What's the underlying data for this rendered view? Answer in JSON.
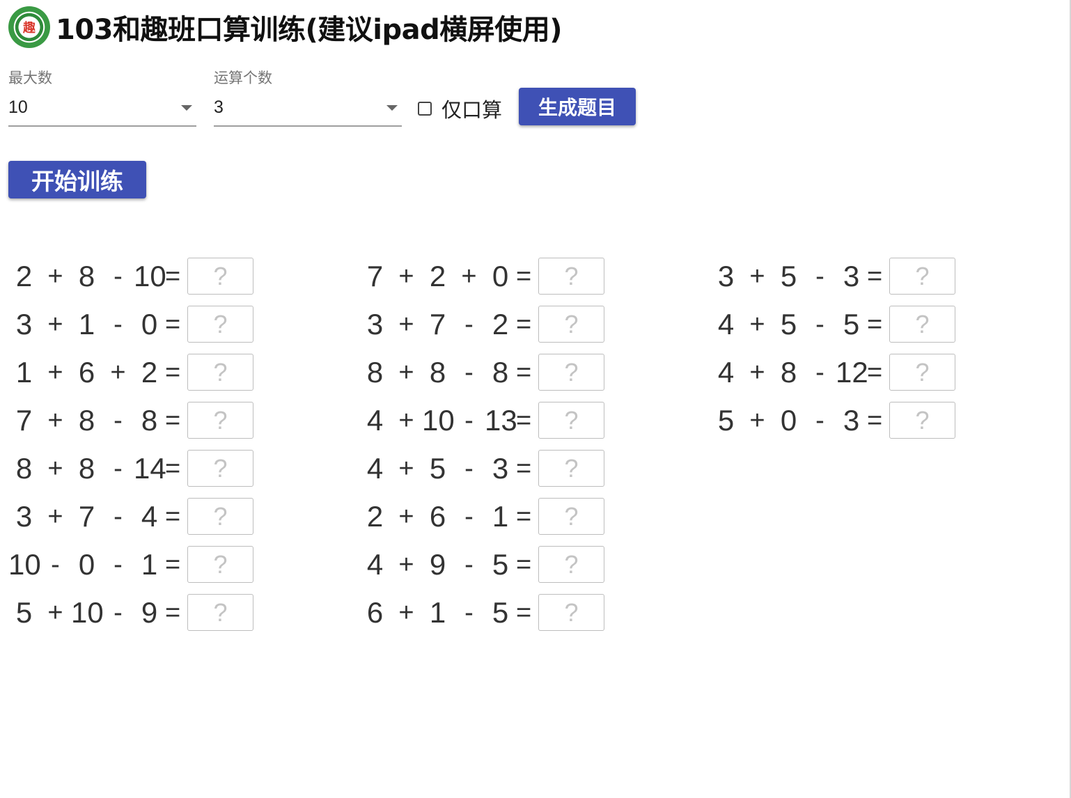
{
  "header": {
    "logo_icon": "school-logo-icon",
    "logo_char": "趣",
    "title": "103和趣班口算训练(建议ipad横屏使用)"
  },
  "controls": {
    "max_number": {
      "label": "最大数",
      "value": "10"
    },
    "operation_count": {
      "label": "运算个数",
      "value": "3"
    },
    "mental_only": {
      "label": "仅口算",
      "checked": false
    },
    "generate_button": "生成题目",
    "start_button": "开始训练"
  },
  "answer_placeholder": "?",
  "columns": [
    {
      "problems": [
        [
          "2",
          "+",
          "8",
          "-",
          "10",
          "="
        ],
        [
          "3",
          "+",
          "1",
          "-",
          "0",
          "="
        ],
        [
          "1",
          "+",
          "6",
          "+",
          "2",
          "="
        ],
        [
          "7",
          "+",
          "8",
          "-",
          "8",
          "="
        ],
        [
          "8",
          "+",
          "8",
          "-",
          "14",
          "="
        ],
        [
          "3",
          "+",
          "7",
          "-",
          "4",
          "="
        ],
        [
          "10",
          "-",
          "0",
          "-",
          "1",
          "="
        ],
        [
          "5",
          "+",
          "10",
          "-",
          "9",
          "="
        ]
      ]
    },
    {
      "problems": [
        [
          "7",
          "+",
          "2",
          "+",
          "0",
          "="
        ],
        [
          "3",
          "+",
          "7",
          "-",
          "2",
          "="
        ],
        [
          "8",
          "+",
          "8",
          "-",
          "8",
          "="
        ],
        [
          "4",
          "+",
          "10",
          "-",
          "13",
          "="
        ],
        [
          "4",
          "+",
          "5",
          "-",
          "3",
          "="
        ],
        [
          "2",
          "+",
          "6",
          "-",
          "1",
          "="
        ],
        [
          "4",
          "+",
          "9",
          "-",
          "5",
          "="
        ],
        [
          "6",
          "+",
          "1",
          "-",
          "5",
          "="
        ]
      ]
    },
    {
      "problems": [
        [
          "3",
          "+",
          "5",
          "-",
          "3",
          "="
        ],
        [
          "4",
          "+",
          "5",
          "-",
          "5",
          "="
        ],
        [
          "4",
          "+",
          "8",
          "-",
          "12",
          "="
        ],
        [
          "5",
          "+",
          "0",
          "-",
          "3",
          "="
        ]
      ]
    }
  ]
}
